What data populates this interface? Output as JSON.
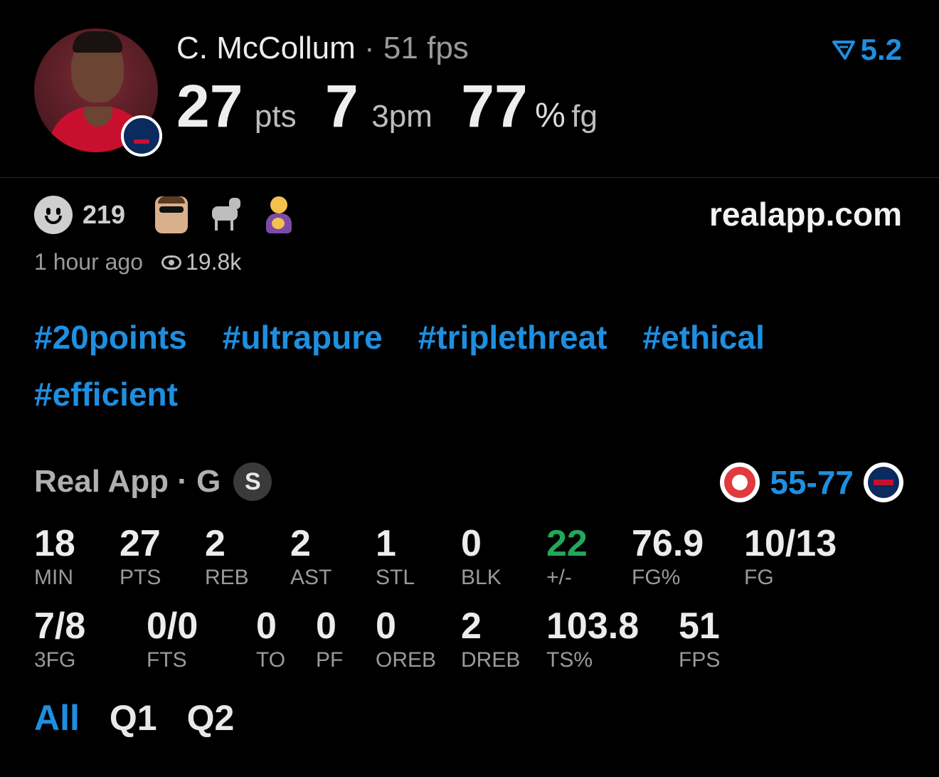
{
  "player": {
    "name": "C. McCollum",
    "separator": "·",
    "fps": "51 fps",
    "stats": {
      "pts_value": "27",
      "pts_unit": "pts",
      "threes_value": "7",
      "threes_unit": "3pm",
      "fg_value": "77",
      "fg_pct": "%",
      "fg_unit": "fg"
    },
    "rating": "5.2"
  },
  "reactions": {
    "count": "219",
    "emojis": [
      "sunglasses-face",
      "goat",
      "mother-child"
    ],
    "site": "realapp.com"
  },
  "meta": {
    "time": "1 hour ago",
    "views": "19.8k"
  },
  "tags": [
    "#20points",
    "#ultrapure",
    "#triplethreat",
    "#ethical",
    "#efficient"
  ],
  "game": {
    "source": "Real App · G",
    "badge": "S",
    "score": "55-77",
    "row1": [
      {
        "value": "18",
        "label": "MIN"
      },
      {
        "value": "27",
        "label": "PTS"
      },
      {
        "value": "2",
        "label": "REB"
      },
      {
        "value": "2",
        "label": "AST"
      },
      {
        "value": "1",
        "label": "STL"
      },
      {
        "value": "0",
        "label": "BLK"
      },
      {
        "value": "22",
        "label": "+/-"
      },
      {
        "value": "76.9",
        "label": "FG%"
      },
      {
        "value": "10/13",
        "label": "FG"
      }
    ],
    "row2": [
      {
        "value": "7/8",
        "label": "3FG"
      },
      {
        "value": "0/0",
        "label": "FTS"
      },
      {
        "value": "0",
        "label": "TO"
      },
      {
        "value": "0",
        "label": "PF"
      },
      {
        "value": "0",
        "label": "OREB"
      },
      {
        "value": "2",
        "label": "DREB"
      },
      {
        "value": "103.8",
        "label": "TS%"
      },
      {
        "value": "51",
        "label": "FPS"
      }
    ]
  },
  "periods": [
    "All",
    "Q1",
    "Q2"
  ],
  "colors": {
    "accent": "#1e8fe0",
    "positive": "#22a85a",
    "background": "#000000"
  }
}
